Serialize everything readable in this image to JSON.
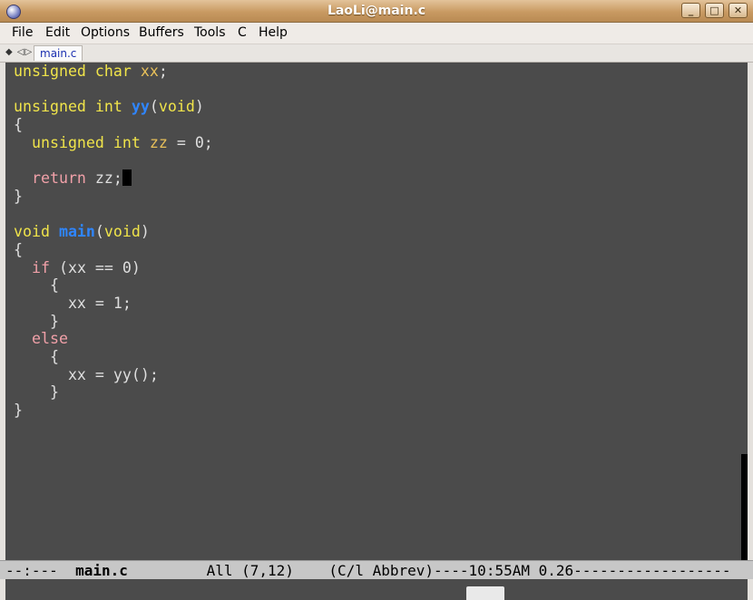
{
  "window": {
    "title": "LaoLi@main.c",
    "buttons": {
      "minimize": "_",
      "maximize": "□",
      "close": "✕"
    }
  },
  "menu": [
    "File",
    "Edit",
    "Options",
    "Buffers",
    "Tools",
    "C",
    "Help"
  ],
  "tabbar": {
    "arrows": "◆ ◁▷",
    "tab_label": "main.c"
  },
  "code_lines": [
    [
      {
        "t": "unsigned char ",
        "c": "kw"
      },
      {
        "t": "xx",
        "c": "var"
      },
      {
        "t": ";",
        "c": ""
      }
    ],
    [],
    [
      {
        "t": "unsigned int ",
        "c": "kw"
      },
      {
        "t": "yy",
        "c": "fn"
      },
      {
        "t": "(",
        "c": ""
      },
      {
        "t": "void",
        "c": "kw"
      },
      {
        "t": ")",
        "c": ""
      }
    ],
    [
      {
        "t": "{",
        "c": ""
      }
    ],
    [
      {
        "t": "  ",
        "c": ""
      },
      {
        "t": "unsigned int ",
        "c": "kw"
      },
      {
        "t": "zz",
        "c": "var"
      },
      {
        "t": " = 0;",
        "c": ""
      }
    ],
    [],
    [
      {
        "t": "  ",
        "c": ""
      },
      {
        "t": "return",
        "c": "ctl"
      },
      {
        "t": " zz;",
        "c": ""
      },
      {
        "t": "",
        "c": "cursor"
      }
    ],
    [
      {
        "t": "}",
        "c": ""
      }
    ],
    [],
    [
      {
        "t": "void ",
        "c": "kw"
      },
      {
        "t": "main",
        "c": "fn"
      },
      {
        "t": "(",
        "c": ""
      },
      {
        "t": "void",
        "c": "kw"
      },
      {
        "t": ")",
        "c": ""
      }
    ],
    [
      {
        "t": "{",
        "c": ""
      }
    ],
    [
      {
        "t": "  ",
        "c": ""
      },
      {
        "t": "if",
        "c": "ctl"
      },
      {
        "t": " (xx == 0)",
        "c": ""
      }
    ],
    [
      {
        "t": "    {",
        "c": ""
      }
    ],
    [
      {
        "t": "      xx = 1;",
        "c": ""
      }
    ],
    [
      {
        "t": "    }",
        "c": ""
      }
    ],
    [
      {
        "t": "  ",
        "c": ""
      },
      {
        "t": "else",
        "c": "ctl"
      }
    ],
    [
      {
        "t": "    {",
        "c": ""
      }
    ],
    [
      {
        "t": "      xx = yy();",
        "c": ""
      }
    ],
    [
      {
        "t": "    }",
        "c": ""
      }
    ],
    [
      {
        "t": "}",
        "c": ""
      }
    ]
  ],
  "modeline": {
    "prefix": "--:---  ",
    "buffer": "main.c",
    "gap": "         ",
    "position": "All (7,12)",
    "gap2": "    ",
    "mode": "(C/l Abbrev)",
    "rest": "----10:55AM 0.26------------------"
  },
  "colors": {
    "background": "#4b4b4b",
    "keyword": "#f0e44a",
    "function": "#2f86ff",
    "control": "#f0a0a8",
    "text": "#dedede"
  }
}
